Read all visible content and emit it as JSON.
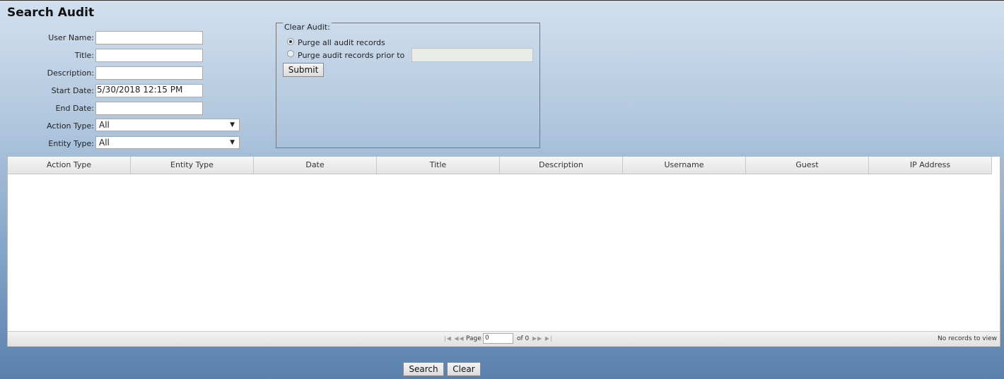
{
  "page": {
    "title": "Search Audit"
  },
  "search_form": {
    "user_name_label": "User Name:",
    "user_name_value": "",
    "title_label": "Title:",
    "title_value": "",
    "description_label": "Description:",
    "description_value": "",
    "start_date_label": "Start Date:",
    "start_date_value": "5/30/2018 12:15 PM",
    "end_date_label": "End Date:",
    "end_date_value": "",
    "action_type_label": "Action Type:",
    "action_type_value": "All",
    "entity_type_label": "Entity Type:",
    "entity_type_value": "All"
  },
  "clear_audit": {
    "legend": "Clear Audit:",
    "option_all": "Purge all audit records",
    "option_prior": "Purge audit records prior to",
    "selected_option": "all",
    "prior_date_value": "",
    "submit_label": "Submit"
  },
  "grid": {
    "columns": [
      "Action Type",
      "Entity Type",
      "Date",
      "Title",
      "Description",
      "Username",
      "Guest",
      "IP Address"
    ],
    "rows": []
  },
  "pager": {
    "page_label": "Page",
    "page_value": "0",
    "of_label": "of 0",
    "records_text": "No records to view"
  },
  "actions": {
    "search_label": "Search",
    "clear_label": "Clear"
  },
  "icons": {
    "select_arrow": "▼",
    "first_page": "first-page-icon",
    "prev_page": "prev-page-icon",
    "next_page": "next-page-icon",
    "last_page": "last-page-icon"
  }
}
